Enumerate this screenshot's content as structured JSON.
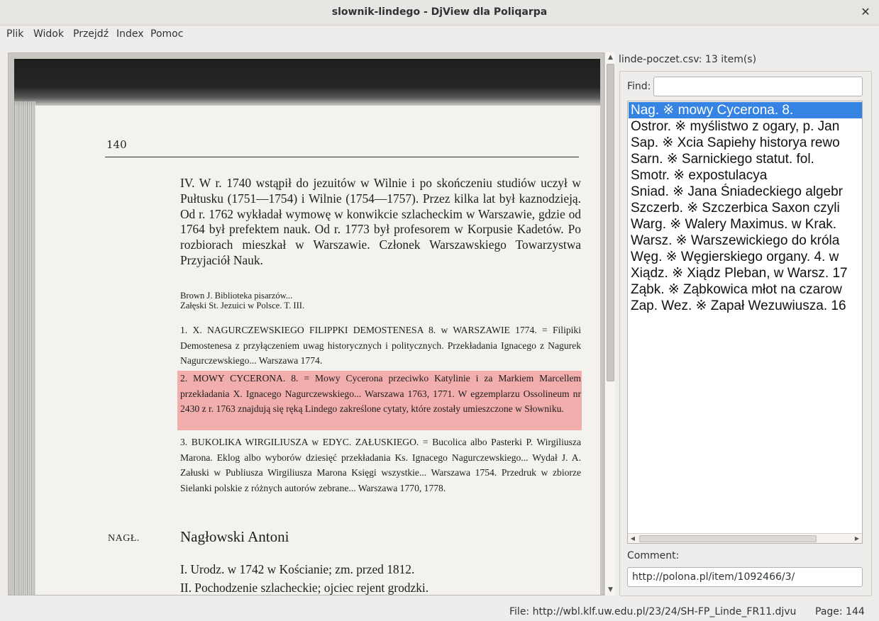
{
  "window": {
    "title": "slownik-lindego - DjView dla Poliqarpa",
    "close_glyph": "✕"
  },
  "menu": [
    "Plik",
    "Widok",
    "Przejdź",
    "Index",
    "Pomoc"
  ],
  "document": {
    "page_number": "140",
    "paragraph_1": "IV. W r. 1740 wstąpił do jezuitów w Wilnie i po skończeniu studiów uczył w Pułtusku (1751—1754) i Wilnie (1754—1757). Przez kilka lat był kaznodzieją. Od r. 1762 wykładał wymowę w konwikcie szlacheckim w Warszawie, gdzie od 1764 był prefektem nauk. Od r. 1773 był profesorem w Korpusie Kadetów. Po rozbiorach mieszkał w Warszawie. Członek Warszawskiego Towarzystwa Przyjaciół Nauk.",
    "biblio_1": "Brown J. Biblioteka pisarzów...",
    "biblio_2": "Załęski St. Jezuici w Polsce. T. III.",
    "entry_1": "1. X. NAGURCZEWSKIEGO FILIPPKI DEMOSTENESA 8. w WARSZAWIE 1774. = Filipiki Demostenesa z przyłączeniem uwag historycznych i politycznych. Przekładania Ignacego z Nagurek Nagurczewskiego... Warszawa 1774.",
    "entry_2": "2. MOWY CYCERONA. 8. = Mowy Cycerona przeciwko Katylinie i za Markiem Marcellem przekładania X. Ignacego Nagurczewskiego... Warszawa 1763, 1771. W egzemplarzu Ossolineum nr 2430 z r. 1763 znajdują się ręką Lindego zakreślone cytaty, które zostały umieszczone w Słowniku.",
    "entry_3": "3. BUKOLIKA WIRGILIUSZA w EDYC. ZAŁUSKIEGO. = Bucolica albo Pasterki P. Wirgiliusza Marona. Eklog albo wyborów dziesięć przekładania Ks. Ignacego Nagurczewskiego... Wydał J. A. Załuski w Publiusza Wirgiliusza Marona Księgi wszystkie... Warszawa 1754. Przedruk w zbiorze Sielanki polskie z różnych autorów zebrane... Warszawa 1770, 1778.",
    "sigla": "NAGŁ.",
    "author_name": "Nagłowski Antoni",
    "line_1": "I. Urodz. w 1742 w Kościanie; zm. przed 1812.",
    "line_2": "II. Pochodzenie szlacheckie; ojciec rejent grodzki."
  },
  "panel": {
    "title": "linde-poczet.csv: 13 item(s)",
    "find_label": "Find:",
    "find_value": "",
    "items": [
      "Nag.  ※ mowy Cycerona. 8.",
      "Ostror.  ※ myślistwo z ogary, p. Jan",
      "Sap.  ※ Xcia Sapiehy historya rewo",
      "Sarn.  ※ Sarnickiego statut. fol.",
      "Smotr.  ※ expostulacya",
      "Sniad.  ※ Jana Śniadeckiego algebr",
      "Szczerb.  ※ Szczerbica Saxon czyli",
      "Warg.  ※ Walery Maximus. w Krak.",
      "Warsz.  ※ Warszewickiego do króla",
      "Węg.  ※ Węgierskiego organy. 4. w",
      "Xiądz.  ※ Xiądz Pleban, w Warsz. 17",
      "Ząbk.  ※ Ząbkowica młot na czarow",
      "Zap. Wez.  ※ Zapał Wezuwiusza. 16"
    ],
    "selected_index": 0,
    "comment_label": "Comment:",
    "comment_value": "http://polona.pl/item/1092466/3/"
  },
  "status": {
    "file": "File: http://wbl.klf.uw.edu.pl/23/24/SH-FP_Linde_FR11.djvu",
    "page": "Page: 144"
  },
  "colors": {
    "selection": "#3584e4",
    "highlight": "#f05050"
  }
}
